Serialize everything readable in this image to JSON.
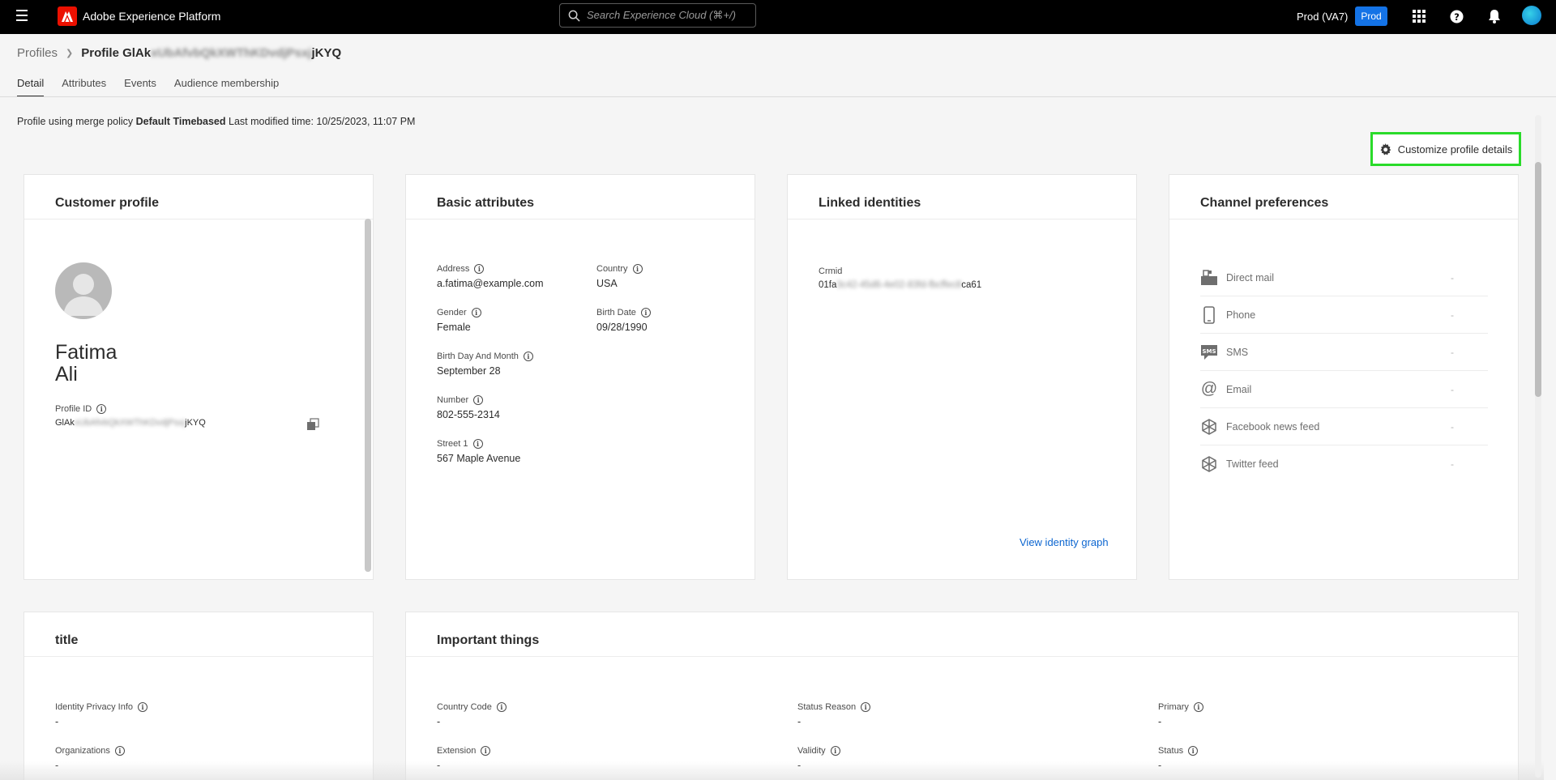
{
  "topbar": {
    "app_title": "Adobe Experience Platform",
    "search_placeholder": "Search Experience Cloud (⌘+/)",
    "org": "Prod (VA7)",
    "sandbox_badge": "Prod"
  },
  "breadcrumb": {
    "root": "Profiles",
    "current_prefix": "Profile GlAk",
    "current_blur": "xUbAfvbQkXWThKDvdjPsxj",
    "current_suffix": "jKYQ"
  },
  "tabs": [
    "Detail",
    "Attributes",
    "Events",
    "Audience membership"
  ],
  "merge": {
    "prefix": "Profile using merge policy ",
    "policy": "Default Timebased",
    "modified": " Last modified time: 10/25/2023, 11:07 PM"
  },
  "customize_label": "Customize profile details",
  "customer_profile": {
    "title": "Customer profile",
    "first_name": "Fatima",
    "last_name": "Ali",
    "profile_id_label": "Profile ID",
    "profile_id_prefix": "GlAk",
    "profile_id_blur": "xUbAfvbQkXWThKDvdjPsxj",
    "profile_id_suffix": "jKYQ"
  },
  "basic_attributes": {
    "title": "Basic attributes",
    "fields": [
      {
        "label": "Address",
        "value": "a.fatima@example.com"
      },
      {
        "label": "Country",
        "value": "USA"
      },
      {
        "label": "Gender",
        "value": "Female"
      },
      {
        "label": "Birth Date",
        "value": "09/28/1990"
      },
      {
        "label": "Birth Day And Month",
        "value": "September 28"
      },
      {
        "label": "Number",
        "value": "802-555-2314"
      },
      {
        "label": "Street 1",
        "value": "567 Maple Avenue"
      }
    ]
  },
  "linked_identities": {
    "title": "Linked identities",
    "namespace": "Crmid",
    "id_prefix": "01fa",
    "id_blur": "3c42-45d6-4e02-83fd-fbcffec8",
    "id_suffix": "ca61",
    "view_graph": "View identity graph"
  },
  "channel_preferences": {
    "title": "Channel preferences",
    "channels": [
      {
        "label": "Direct mail",
        "value": "-",
        "icon": "mailbox-icon"
      },
      {
        "label": "Phone",
        "value": "-",
        "icon": "phone-icon"
      },
      {
        "label": "SMS",
        "value": "-",
        "icon": "sms-icon"
      },
      {
        "label": "Email",
        "value": "-",
        "icon": "at-sign-icon"
      },
      {
        "label": "Facebook news feed",
        "value": "-",
        "icon": "feed-icon"
      },
      {
        "label": "Twitter feed",
        "value": "-",
        "icon": "feed-icon"
      }
    ]
  },
  "title_card": {
    "title": "title",
    "fields": [
      {
        "label": "Identity Privacy Info",
        "value": "-"
      },
      {
        "label": "Organizations",
        "value": "-"
      }
    ]
  },
  "important_things": {
    "title": "Important things",
    "fields": [
      {
        "label": "Country Code",
        "value": "-"
      },
      {
        "label": "Status Reason",
        "value": "-"
      },
      {
        "label": "Primary",
        "value": "-"
      },
      {
        "label": "Extension",
        "value": "-"
      },
      {
        "label": "Validity",
        "value": "-"
      },
      {
        "label": "Status",
        "value": "-"
      }
    ]
  },
  "colors": {
    "accent": "#1473e6",
    "link": "#0d66d0",
    "highlight": "#2adb2a",
    "adobe_red": "#eb1000"
  }
}
